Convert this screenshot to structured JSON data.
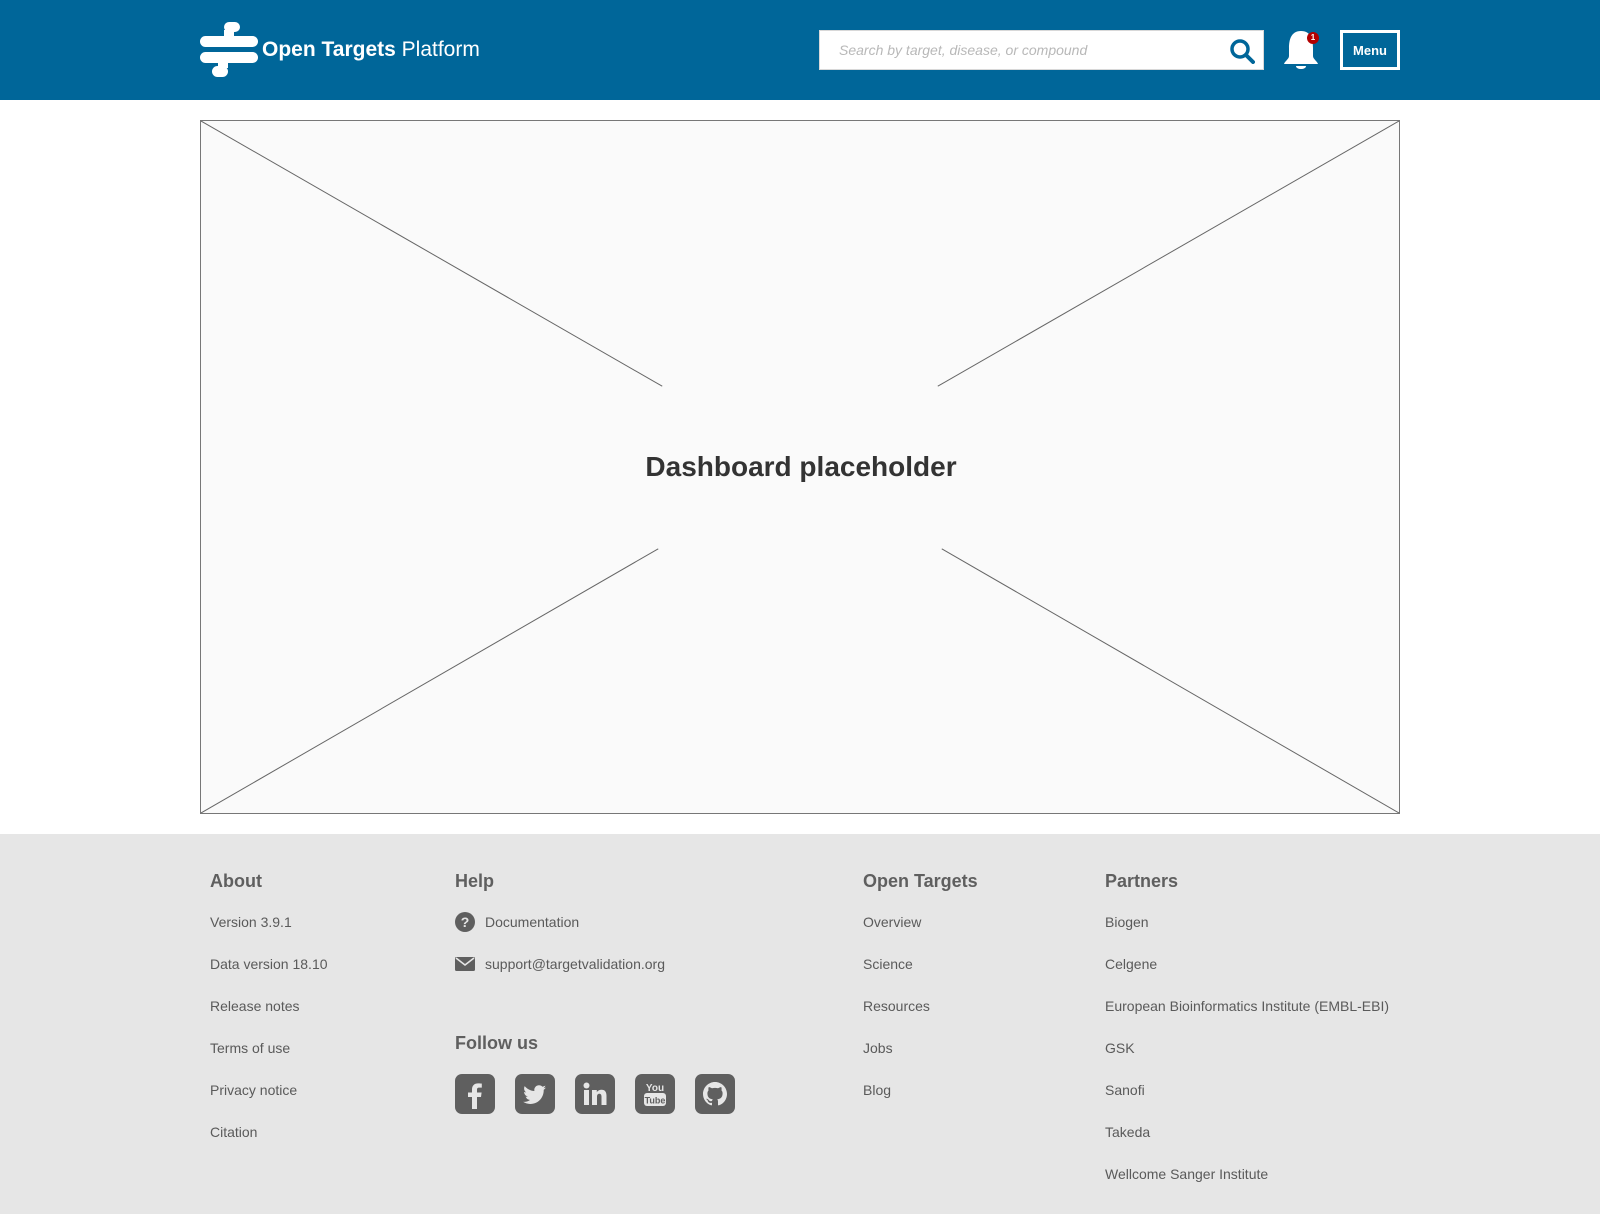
{
  "header": {
    "logo_bold": "Open Targets",
    "logo_light": "Platform",
    "search_placeholder": "Search by target, disease, or compound",
    "notification_count": "1",
    "menu_label": "Menu",
    "background_color": "#006699"
  },
  "main": {
    "placeholder_title": "Dashboard placeholder"
  },
  "footer": {
    "about": {
      "heading": "About",
      "links": [
        "Version 3.9.1",
        "Data version 18.10",
        "Release notes",
        "Terms of use",
        "Privacy notice",
        "Citation"
      ]
    },
    "help": {
      "heading": "Help",
      "links": [
        {
          "icon": "question-circle-icon",
          "label": "Documentation"
        },
        {
          "icon": "envelope-icon",
          "label": "support@targetvalidation.org"
        }
      ],
      "follow_heading": "Follow us",
      "social": [
        "facebook-icon",
        "twitter-icon",
        "linkedin-icon",
        "youtube-icon",
        "github-icon"
      ]
    },
    "open_targets": {
      "heading": "Open Targets",
      "links": [
        "Overview",
        "Science",
        "Resources",
        "Jobs",
        "Blog"
      ]
    },
    "partners": {
      "heading": "Partners",
      "links": [
        "Biogen",
        "Celgene",
        "European Bioinformatics Institute (EMBL-EBI)",
        "GSK",
        "Sanofi",
        "Takeda",
        "Wellcome Sanger Institute"
      ]
    },
    "background_color": "#e6e6e6"
  }
}
